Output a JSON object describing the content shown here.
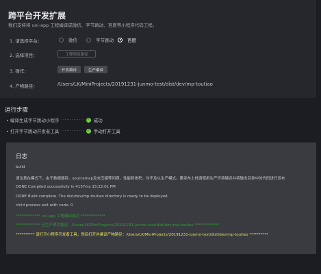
{
  "header": {
    "title": "跨平台开发扩展",
    "description": "我们支持将 uni-app 工程编译成微信、字节跳动、百度等小程序代码工程。"
  },
  "form": {
    "platform_label": "1. 请选择平台：",
    "platforms": [
      {
        "label": "微信",
        "selected": false
      },
      {
        "label": "字节跳动",
        "selected": false
      },
      {
        "label": "百度",
        "selected": true
      }
    ],
    "project_label": "2. 选择项目：",
    "project_button": "工程项目路径",
    "action_label": "3. 操作：",
    "dev_compile_button": "开发编译",
    "prod_compile_button": "生产编译",
    "output_label": "4. 产物路径：",
    "output_path": "/Users/LK/MiniProjects/20191231-junmo-test/dist/dev/mp-toutiao"
  },
  "steps": {
    "title": "运行步骤",
    "items": [
      {
        "label": "• 编译生成字节跳动小程序",
        "dots": "·············",
        "status": "成功"
      },
      {
        "label": "• 打开字节跳动开发者工具",
        "dots": "·············",
        "status": "手动打开工具"
      }
    ]
  },
  "log": {
    "title": "日志",
    "lines": [
      {
        "text": "build",
        "style": "normal"
      },
      {
        "text": "请注意在模式下，由于数据缓存、sourcemap及未压缩等问题，性能和体积，均不及以生产模式。要发布上线请使用生产环境编译并将输出目录中的代码进行发布",
        "style": "normal"
      },
      {
        "text": "DONE Compiled successfully in 4157ms 15:22:01 PM",
        "style": "normal"
      },
      {
        "text": "DONE Build complete. The dist/dev/mp-toutiao directory is ready to be deployed.",
        "style": "normal"
      },
      {
        "text": "child process exit with code: 0",
        "style": "normal"
      },
      {
        "text": "************* uni-app 工程编译成功 *************",
        "style": "green"
      },
      {
        "text": "************* 已生产项目路径：/Users/LK/MiniProjects/20191231-junmo-test/dist/dev/mp-toutiao *************",
        "style": "green"
      },
      {
        "text": "********** 请打开小程序开发者工具，然后打开并编译产物路径：/Users/LK/MiniProjects/20191231-junmo-test/dist/dev/mp-toutiao **********",
        "style": "yellow"
      }
    ]
  },
  "colors": {
    "background": "#1c1d22",
    "panel": "#26272d",
    "log_panel": "#3a3b41",
    "success": "#6fd33a",
    "log_green": "#2fb12f",
    "log_yellow": "#e8e25a"
  }
}
